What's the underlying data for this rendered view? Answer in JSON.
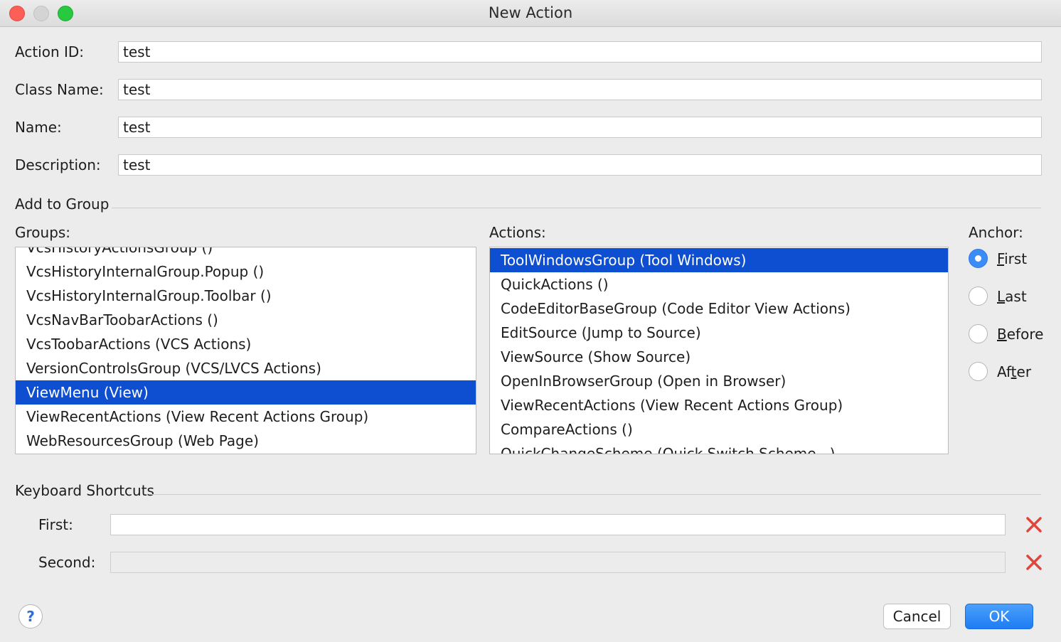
{
  "window": {
    "title": "New Action"
  },
  "form": {
    "action_id": {
      "label": "Action ID:",
      "value": "test"
    },
    "class_name": {
      "label": "Class Name:",
      "value": "test"
    },
    "name": {
      "label": "Name:",
      "value": "test"
    },
    "description": {
      "label": "Description:",
      "value": "test"
    }
  },
  "add_to_group": {
    "section_title": "Add to Group",
    "groups_label": "Groups:",
    "groups": [
      "VcsHistoryActionsGroup ()",
      "VcsHistoryInternalGroup.Popup ()",
      "VcsHistoryInternalGroup.Toolbar ()",
      "VcsNavBarToobarActions ()",
      "VcsToobarActions (VCS Actions)",
      "VersionControlsGroup (VCS/LVCS Actions)",
      "ViewMenu (View)",
      "ViewRecentActions (View Recent Actions Group)",
      "WebResourcesGroup (Web Page)"
    ],
    "selected_group": "ViewMenu (View)",
    "actions_label": "Actions:",
    "actions": [
      "ToolWindowsGroup (Tool Windows)",
      "QuickActions ()",
      "CodeEditorBaseGroup (Code Editor View Actions)",
      "EditSource (Jump to Source)",
      "ViewSource (Show Source)",
      "OpenInBrowserGroup (Open in Browser)",
      "ViewRecentActions (View Recent Actions Group)",
      "CompareActions ()",
      "QuickChangeScheme (Quick Switch Scheme...)"
    ],
    "selected_action": "ToolWindowsGroup (Tool Windows)",
    "anchor": {
      "label": "Anchor:",
      "options": [
        {
          "label": "First",
          "mnemonic": "F",
          "selected": true
        },
        {
          "label": "Last",
          "mnemonic": "L",
          "selected": false
        },
        {
          "label": "Before",
          "mnemonic": "B",
          "selected": false
        },
        {
          "label": "After",
          "mnemonic": "t",
          "selected": false
        }
      ]
    }
  },
  "keyboard_shortcuts": {
    "section_title": "Keyboard Shortcuts",
    "first": {
      "label": "First:",
      "value": ""
    },
    "second": {
      "label": "Second:",
      "value": ""
    },
    "clear_icon": "clear-x-icon"
  },
  "footer": {
    "help_label": "?",
    "cancel_label": "Cancel",
    "ok_label": "OK"
  },
  "colors": {
    "selection": "#0e4fd1",
    "primary_button": "#1f7cf3",
    "clear_icon": "#e0443a"
  }
}
